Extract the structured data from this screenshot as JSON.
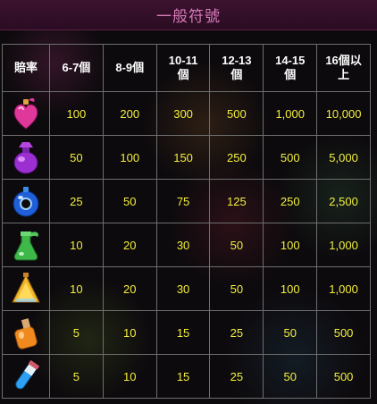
{
  "title": "一般符號",
  "columns": [
    "賠率",
    "6-7個",
    "8-9個",
    "10-11個",
    "12-13個",
    "14-15個",
    "16個以上"
  ],
  "header_lines": [
    [
      "賠率"
    ],
    [
      "6-7個"
    ],
    [
      "8-9個"
    ],
    [
      "10-11",
      "個"
    ],
    [
      "12-13",
      "個"
    ],
    [
      "14-15",
      "個"
    ],
    [
      "16個以",
      "上"
    ]
  ],
  "rows": [
    {
      "icon": "pink-heart-potion-icon",
      "values": [
        "100",
        "200",
        "300",
        "500",
        "1,000",
        "10,000"
      ]
    },
    {
      "icon": "purple-round-potion-icon",
      "values": [
        "50",
        "100",
        "150",
        "250",
        "500",
        "5,000"
      ]
    },
    {
      "icon": "blue-ring-potion-icon",
      "values": [
        "25",
        "50",
        "75",
        "125",
        "250",
        "2,500"
      ]
    },
    {
      "icon": "green-potion-icon",
      "values": [
        "10",
        "20",
        "30",
        "50",
        "100",
        "1,000"
      ]
    },
    {
      "icon": "yellow-cone-potion-icon",
      "values": [
        "10",
        "20",
        "30",
        "50",
        "100",
        "1,000"
      ]
    },
    {
      "icon": "orange-bottle-potion-icon",
      "values": [
        "5",
        "10",
        "15",
        "25",
        "50",
        "500"
      ]
    },
    {
      "icon": "blue-test-tube-icon",
      "values": [
        "5",
        "10",
        "15",
        "25",
        "50",
        "500"
      ]
    }
  ],
  "colors": {
    "title": "#d77bb9",
    "value": "#f3ef3b",
    "header": "#ffffff",
    "border": "#6e6e6e"
  }
}
